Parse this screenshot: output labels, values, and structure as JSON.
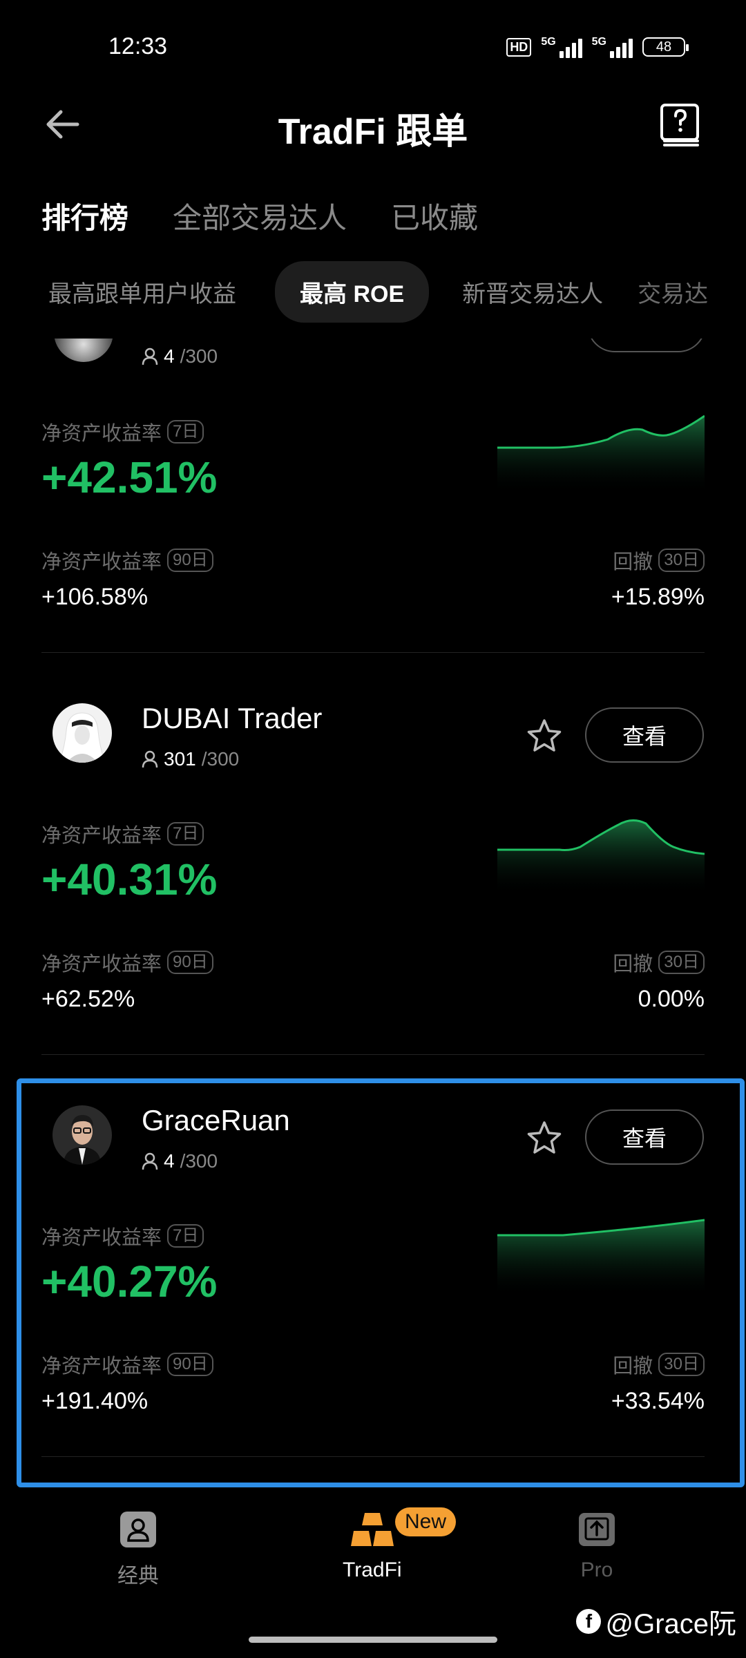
{
  "status": {
    "time": "12:33",
    "hd": "HD",
    "net1": "5G",
    "net2": "5G",
    "battery": "48"
  },
  "header": {
    "title": "TradFi 跟单"
  },
  "tabs": [
    {
      "label": "排行榜",
      "active": true
    },
    {
      "label": "全部交易达人",
      "active": false
    },
    {
      "label": "已收藏",
      "active": false
    }
  ],
  "subtabs": [
    {
      "label": "最高跟单用户收益"
    },
    {
      "label": "最高 ROE"
    },
    {
      "label": "新晋交易达人"
    },
    {
      "label": "交易达"
    }
  ],
  "metric_labels": {
    "roe": "净资产收益率",
    "drawdown": "回撤",
    "d7": "7日",
    "d90": "90日",
    "d30": "30日"
  },
  "view_label": "查看",
  "traders": [
    {
      "name": "",
      "followers": "4",
      "capacity": "/300",
      "roe_7d": "+42.51%",
      "roe_90d": "+106.58%",
      "drawdown_30d": "+15.89%"
    },
    {
      "name": "DUBAI Trader",
      "followers": "301",
      "capacity": "/300",
      "roe_7d": "+40.31%",
      "roe_90d": "+62.52%",
      "drawdown_30d": "0.00%"
    },
    {
      "name": "GraceRuan",
      "followers": "4",
      "capacity": "/300",
      "roe_7d": "+40.27%",
      "roe_90d": "+191.40%",
      "drawdown_30d": "+33.54%"
    }
  ],
  "colors": {
    "accent_green": "#21c064",
    "highlight_blue": "#2e8fe8",
    "badge_orange": "#f5a033"
  },
  "bottom_nav": [
    {
      "label": "经典",
      "icon": "person-card-icon"
    },
    {
      "label": "TradFi",
      "icon": "gold-bars-icon",
      "badge": "New",
      "active": true
    },
    {
      "label": "Pro",
      "icon": "upload-box-icon"
    }
  ],
  "watermark": "@Grace阮"
}
